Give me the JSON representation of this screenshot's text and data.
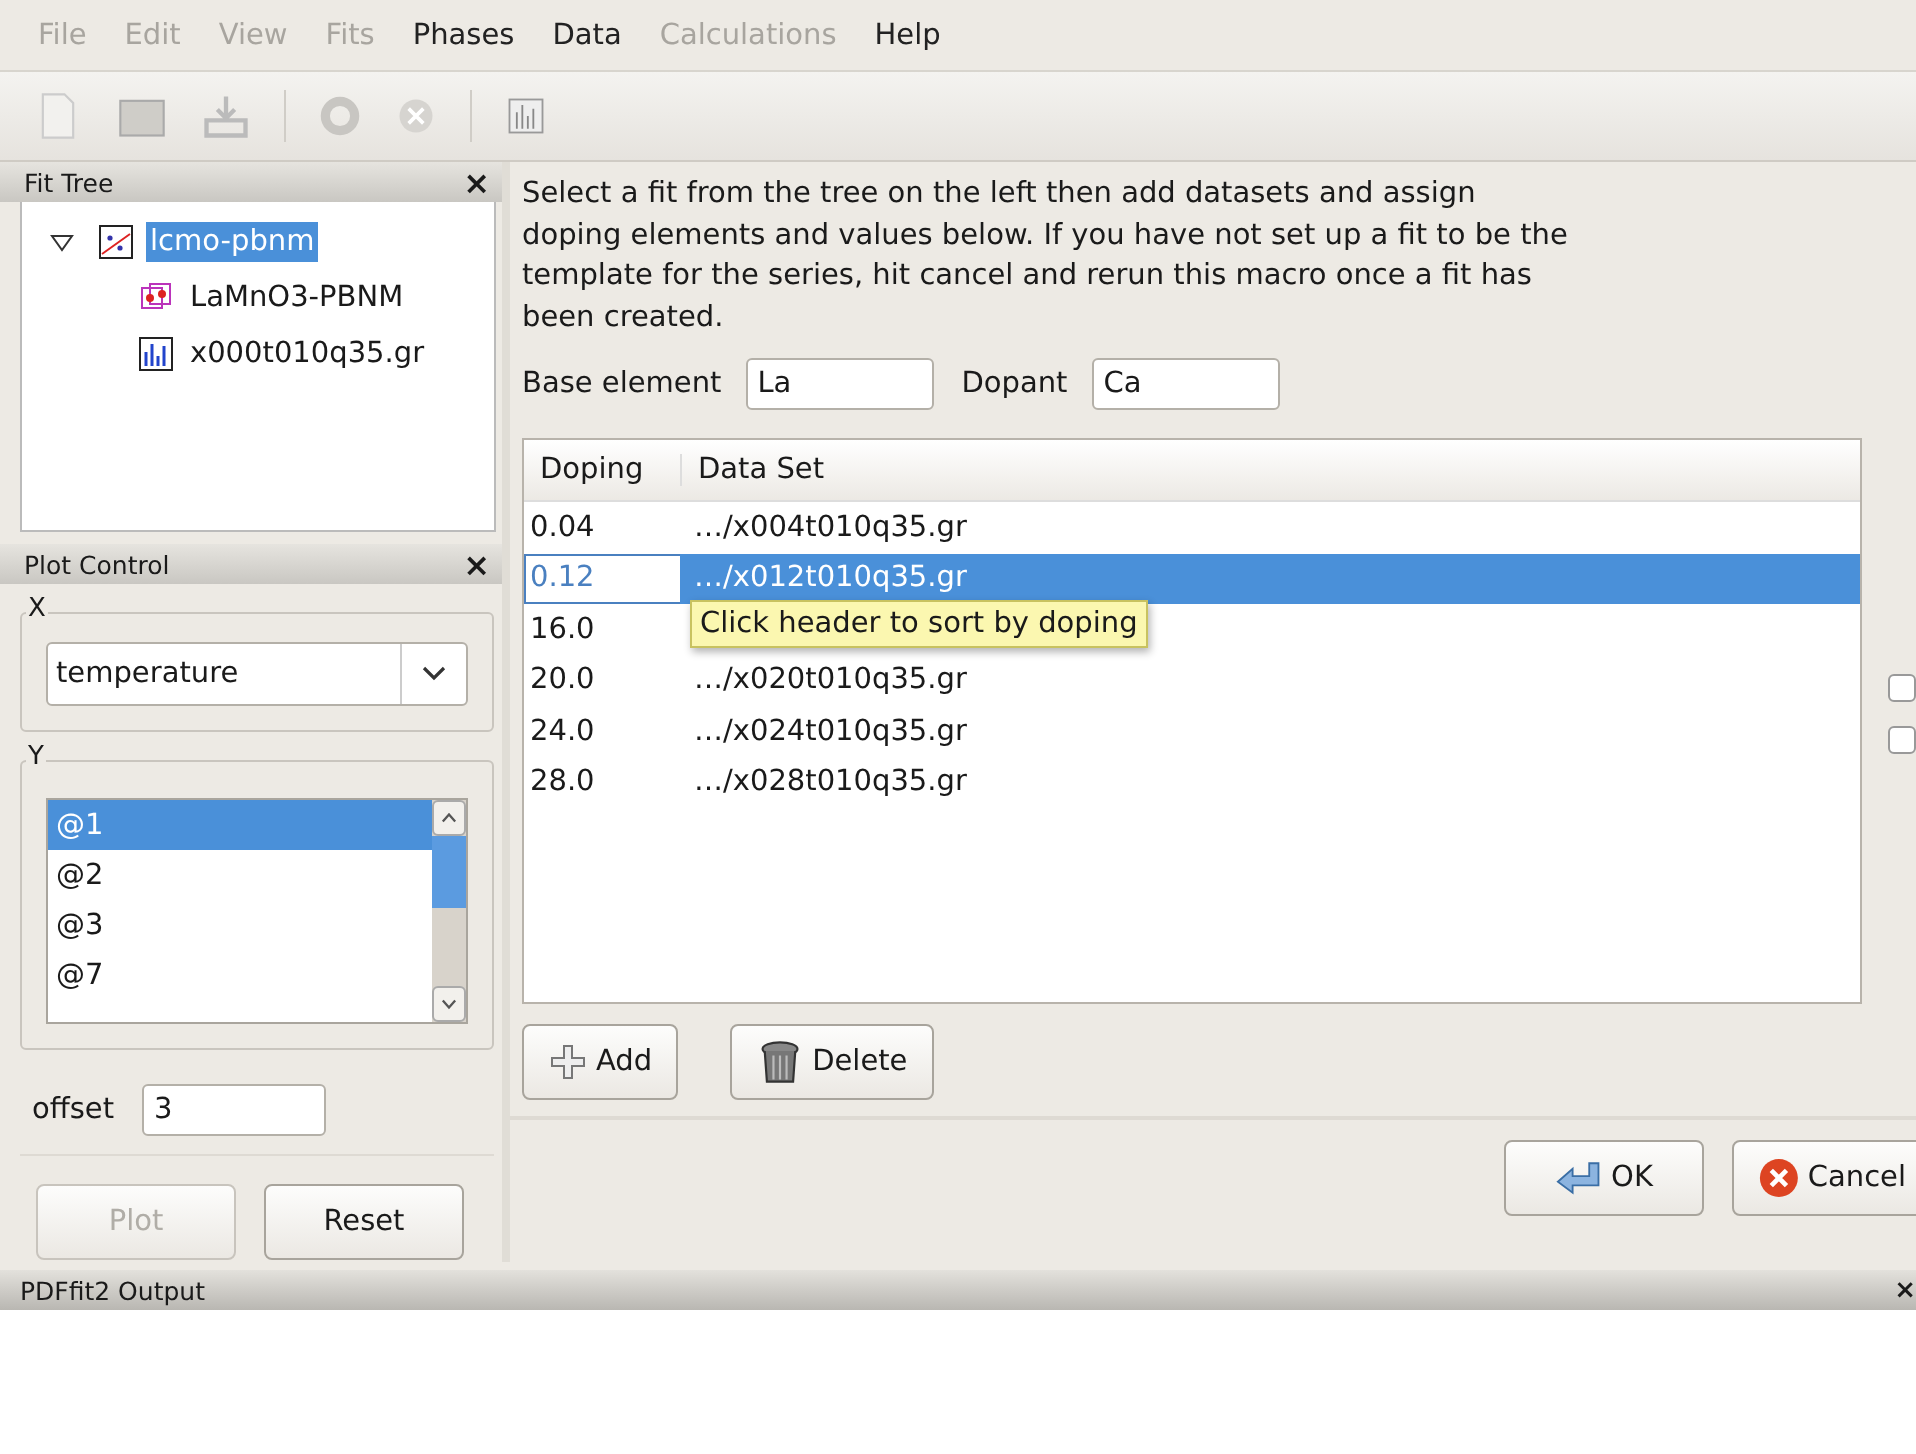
{
  "menu": [
    {
      "label": "File",
      "disabled": true
    },
    {
      "label": "Edit",
      "disabled": true
    },
    {
      "label": "View",
      "disabled": true
    },
    {
      "label": "Fits",
      "disabled": true
    },
    {
      "label": "Phases",
      "disabled": false
    },
    {
      "label": "Data",
      "disabled": false
    },
    {
      "label": "Calculations",
      "disabled": true
    },
    {
      "label": "Help",
      "disabled": false
    }
  ],
  "fit_tree": {
    "title": "Fit Tree",
    "close": "×",
    "items": [
      {
        "label": "lcmo-pbnm",
        "kind": "fit",
        "selected": true,
        "expanded": true,
        "children": [
          {
            "label": "LaMnO3-PBNM",
            "kind": "phase",
            "selected": false
          },
          {
            "label": "x000t010q35.gr",
            "kind": "data",
            "selected": false
          }
        ]
      }
    ]
  },
  "plot_control": {
    "title": "Plot Control",
    "close": "×",
    "x_label": "X",
    "x_value": "temperature",
    "y_label": "Y",
    "y_items": [
      {
        "label": "@1",
        "selected": true
      },
      {
        "label": "@2",
        "selected": false
      },
      {
        "label": "@3",
        "selected": false
      },
      {
        "label": "@7",
        "selected": false
      }
    ],
    "offset_label": "offset",
    "offset_value": "3",
    "plot": {
      "label": "Plot",
      "disabled": true
    },
    "reset": {
      "label": "Reset",
      "disabled": false
    }
  },
  "dialog": {
    "instructions": "Select a fit from the tree on the left then add datasets and assign doping elements and values below. If you have not set up a fit to be the template for the series, hit cancel and rerun this macro once a fit has been created.",
    "base_label": "Base element",
    "base_value": "La",
    "dopant_label": "Dopant",
    "dopant_value": "Ca",
    "columns": [
      "Doping",
      "Data Set"
    ],
    "rows": [
      {
        "doping": "0.04",
        "dataset": "…/x004t010q35.gr",
        "selected": false,
        "editing": false
      },
      {
        "doping": "0.12",
        "dataset": "…/x012t010q35.gr",
        "selected": true,
        "editing": true
      },
      {
        "doping": "16.0",
        "dataset": "",
        "selected": false,
        "editing": false
      },
      {
        "doping": "20.0",
        "dataset": "…/x020t010q35.gr",
        "selected": false,
        "editing": false
      },
      {
        "doping": "24.0",
        "dataset": "…/x024t010q35.gr",
        "selected": false,
        "editing": false
      },
      {
        "doping": "28.0",
        "dataset": "…/x028t010q35.gr",
        "selected": false,
        "editing": false
      }
    ],
    "tooltip": "Click header to sort by doping",
    "add": "Add",
    "delete": "Delete",
    "ok": "OK",
    "cancel": "Cancel",
    "side_checks": [
      {
        "checked": false
      },
      {
        "checked": false
      }
    ]
  },
  "output": {
    "title": "PDFfit2 Output",
    "close": "×"
  }
}
